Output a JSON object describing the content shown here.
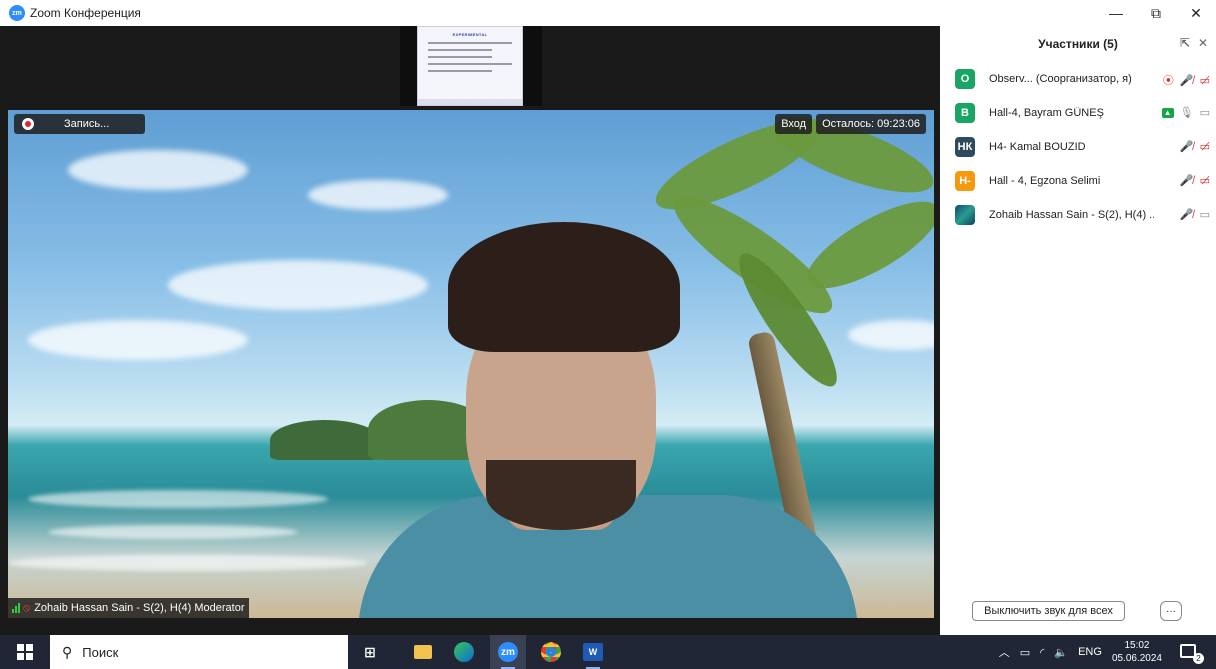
{
  "window": {
    "logo_text": "zm",
    "title": "Zoom Конференция",
    "minimize_glyph": "—",
    "maximize_glyph": "⧉",
    "close_glyph": "✕"
  },
  "meeting": {
    "share_slide_title": "EXPERIMENTAL",
    "record_label": "Запись...",
    "enter_label": "Вход",
    "remaining_label": "Осталось: 09:23:06",
    "speaker_name": "Zohaib Hassan Sain - S(2), H(4) Moderator"
  },
  "participants": {
    "title": "Участники (5)",
    "list": [
      {
        "initials": "O",
        "color": "#19a566",
        "name": "Observ...  (Соорганизатор, я)"
      },
      {
        "initials": "B",
        "color": "#19a566",
        "name": "Hall-4, Bayram GÜNEŞ"
      },
      {
        "initials": "НК",
        "color": "#2e4a5e",
        "name": "H4- Kamal BOUZID"
      },
      {
        "initials": "H-",
        "color": "#f59a0f",
        "name": "Hall - 4, Egzona Selimi"
      },
      {
        "initials": "",
        "color": "#1c6b8f",
        "name": "Zohaib Hassan Sain - S(2), H(4) ..."
      }
    ],
    "mute_all_label": "Выключить звук для всех",
    "more_label": "···"
  },
  "taskbar": {
    "search_placeholder": "Поиск",
    "zoom_label": "zm",
    "word_label": "W",
    "language": "ENG",
    "time": "15:02",
    "date": "05.06.2024",
    "notification_count": "2"
  }
}
